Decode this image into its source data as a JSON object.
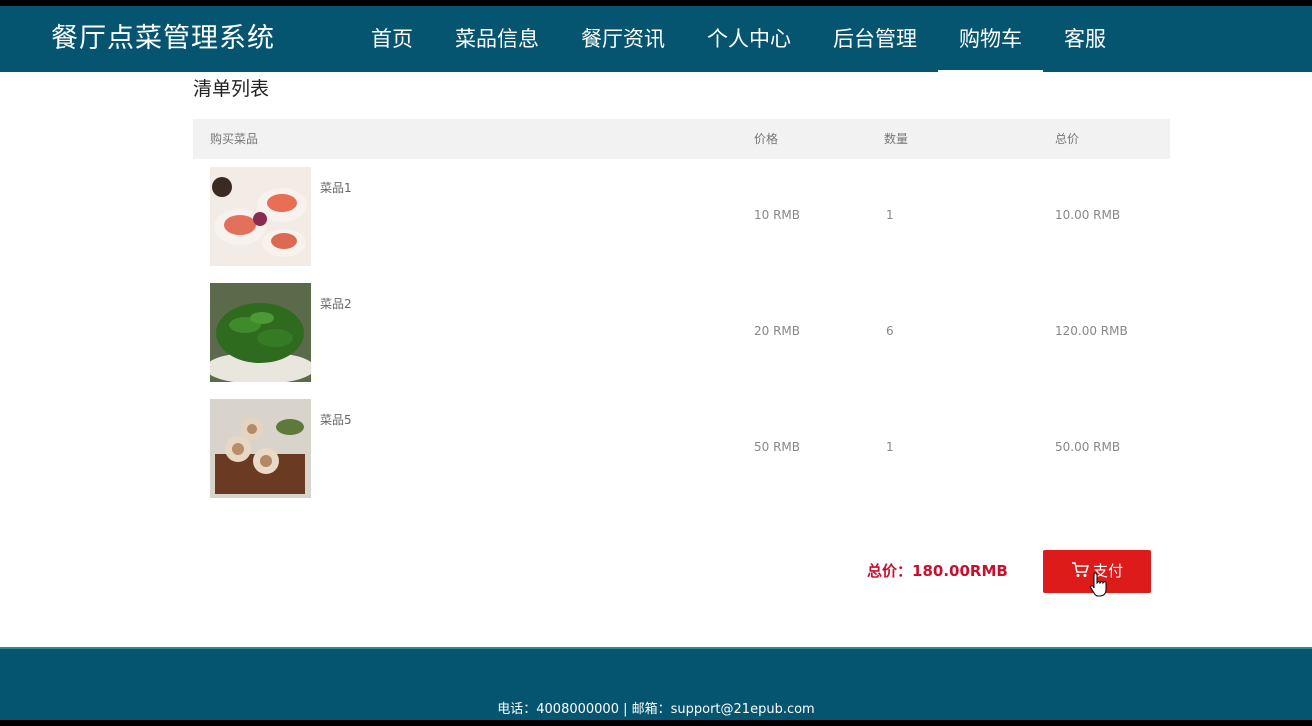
{
  "header": {
    "brand": "餐厅点菜管理系统",
    "nav": [
      "首页",
      "菜品信息",
      "餐厅资讯",
      "个人中心",
      "后台管理",
      "购物车",
      "客服"
    ],
    "active_nav": "购物车"
  },
  "cart": {
    "title": "清单列表",
    "columns": [
      "购买菜品",
      "价格",
      "数量",
      "总价"
    ],
    "items": [
      {
        "name": "菜品1",
        "price": "10 RMB",
        "qty": "1",
        "total": "10.00 RMB"
      },
      {
        "name": "菜品2",
        "price": "20 RMB",
        "qty": "6",
        "total": "120.00 RMB"
      },
      {
        "name": "菜品5",
        "price": "50 RMB",
        "qty": "1",
        "total": "50.00 RMB"
      }
    ],
    "total_label": "总价：",
    "total_value": "180.00RMB",
    "pay_label": "支付",
    "pay_icon": "cart-icon"
  },
  "footer": {
    "text": "电话：4008000000 | 邮箱：support@21epub.com"
  },
  "colors": {
    "header_bg": "#055470",
    "pay_button": "#dd1b1b",
    "total_text": "#c8102e"
  }
}
